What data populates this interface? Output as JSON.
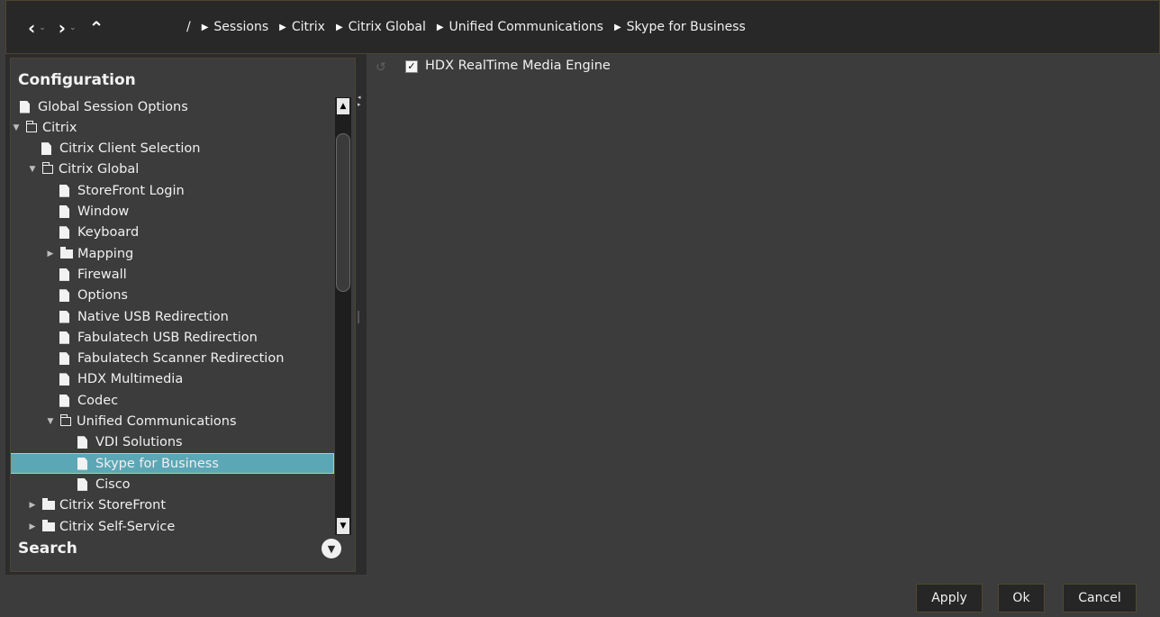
{
  "breadcrumb": {
    "root": "/",
    "items": [
      "Sessions",
      "Citrix",
      "Citrix Global",
      "Unified Communications",
      "Skype for Business"
    ]
  },
  "left_panel": {
    "title": "Configuration",
    "search_label": "Search",
    "tree": [
      {
        "label": "Global Session Options",
        "type": "doc",
        "level": 0,
        "expander": ""
      },
      {
        "label": "Citrix",
        "type": "folder-open",
        "level": 0,
        "expander": "▼"
      },
      {
        "label": "Citrix Client Selection",
        "type": "doc",
        "level": 1,
        "expander": ""
      },
      {
        "label": "Citrix Global",
        "type": "folder-open",
        "level": 1,
        "expander": "▼"
      },
      {
        "label": "StoreFront Login",
        "type": "doc",
        "level": 2,
        "expander": ""
      },
      {
        "label": "Window",
        "type": "doc",
        "level": 2,
        "expander": ""
      },
      {
        "label": "Keyboard",
        "type": "doc",
        "level": 2,
        "expander": ""
      },
      {
        "label": "Mapping",
        "type": "folder-closed",
        "level": 2,
        "expander": "▶"
      },
      {
        "label": "Firewall",
        "type": "doc",
        "level": 2,
        "expander": ""
      },
      {
        "label": "Options",
        "type": "doc",
        "level": 2,
        "expander": ""
      },
      {
        "label": "Native USB Redirection",
        "type": "doc",
        "level": 2,
        "expander": ""
      },
      {
        "label": "Fabulatech USB Redirection",
        "type": "doc",
        "level": 2,
        "expander": ""
      },
      {
        "label": "Fabulatech Scanner Redirection",
        "type": "doc",
        "level": 2,
        "expander": ""
      },
      {
        "label": "HDX Multimedia",
        "type": "doc",
        "level": 2,
        "expander": ""
      },
      {
        "label": "Codec",
        "type": "doc",
        "level": 2,
        "expander": ""
      },
      {
        "label": "Unified Communications",
        "type": "folder-open",
        "level": 2,
        "expander": "▼"
      },
      {
        "label": "VDI Solutions",
        "type": "doc",
        "level": 3,
        "expander": ""
      },
      {
        "label": "Skype for Business",
        "type": "doc",
        "level": 3,
        "expander": "",
        "selected": true
      },
      {
        "label": "Cisco",
        "type": "doc",
        "level": 3,
        "expander": ""
      },
      {
        "label": "Citrix StoreFront",
        "type": "folder-closed",
        "level": 1,
        "expander": "▶"
      },
      {
        "label": "Citrix Self-Service",
        "type": "folder-closed",
        "level": 1,
        "expander": "▶"
      }
    ]
  },
  "content": {
    "option_label": "HDX RealTime Media Engine",
    "option_checked": true,
    "check_glyph": "✓"
  },
  "buttons": {
    "apply": "Apply",
    "ok": "Ok",
    "cancel": "Cancel"
  },
  "icons": {
    "back": "‹",
    "forward": "›",
    "up": "⌃",
    "dropdown": "⌄",
    "crumb_arrow": "▶",
    "scroll_up": "▲",
    "scroll_down": "▼",
    "search_toggle": "▼",
    "refresh": "↺"
  },
  "colors": {
    "selection": "#5ba7b6",
    "selection_border": "#d6d23a",
    "background": "#3c3c3c",
    "bar": "#282828"
  }
}
